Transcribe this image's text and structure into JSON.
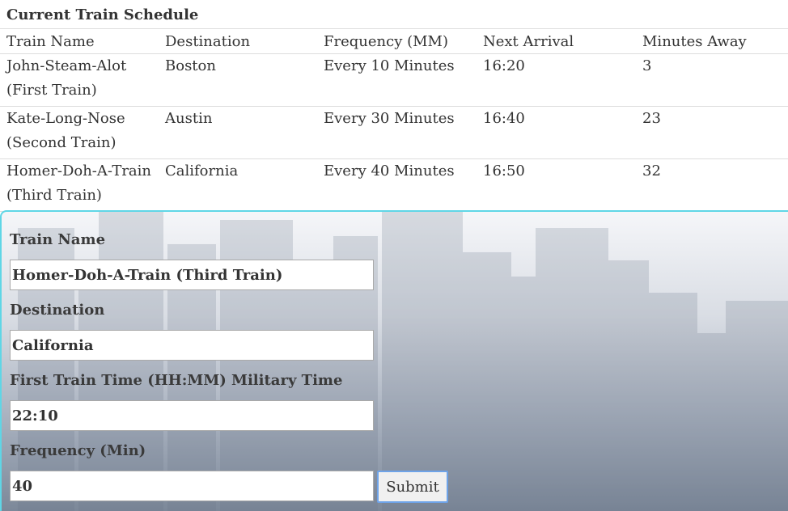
{
  "schedule": {
    "title": "Current Train Schedule",
    "columns": [
      "Train Name",
      "Destination",
      "Frequency (MM)",
      "Next Arrival",
      "Minutes Away"
    ],
    "rows": [
      {
        "name_line1": "John-Steam-Alot",
        "name_line2": "(First Train)",
        "destination": "Boston",
        "frequency": "Every 10 Minutes",
        "next_arrival": "16:20",
        "minutes_away": "3"
      },
      {
        "name_line1": "Kate-Long-Nose",
        "name_line2": "(Second Train)",
        "destination": "Austin",
        "frequency": "Every 30 Minutes",
        "next_arrival": "16:40",
        "minutes_away": "23"
      },
      {
        "name_line1": "Homer-Doh-A-Train",
        "name_line2": "(Third Train)",
        "destination": "California",
        "frequency": "Every 40 Minutes",
        "next_arrival": "16:50",
        "minutes_away": "32"
      }
    ]
  },
  "form": {
    "train_name_label": "Train Name",
    "train_name_value": "Homer-Doh-A-Train (Third Train)",
    "destination_label": "Destination",
    "destination_value": "California",
    "first_time_label": "First Train Time (HH:MM) Military Time",
    "first_time_value": "22:10",
    "frequency_label": "Frequency (Min)",
    "frequency_value": "40",
    "submit_label": "Submit"
  },
  "colors": {
    "panel_border": "#5fd6e6",
    "button_focus_border": "#6ea3e8"
  }
}
